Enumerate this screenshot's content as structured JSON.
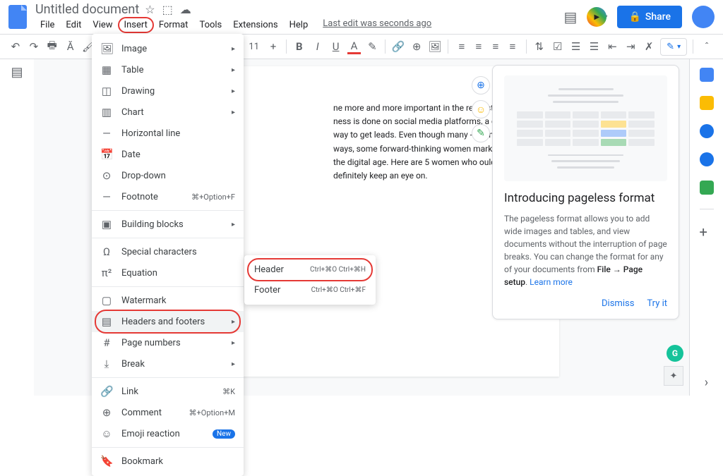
{
  "header": {
    "title": "Untitled document",
    "menus": [
      "File",
      "Edit",
      "View",
      "Insert",
      "Format",
      "Tools",
      "Extensions",
      "Help"
    ],
    "active_menu": "Insert",
    "last_edit": "Last edit was seconds ago",
    "share_label": "Share"
  },
  "toolbar": {
    "font_size": "11",
    "items_after_gap": [
      "B",
      "I",
      "U"
    ]
  },
  "insert_menu": {
    "items": [
      {
        "icon": "🖼",
        "label": "Image",
        "arrow": true
      },
      {
        "icon": "▦",
        "label": "Table",
        "arrow": true
      },
      {
        "icon": "◫",
        "label": "Drawing",
        "arrow": true
      },
      {
        "icon": "▥",
        "label": "Chart",
        "arrow": true
      },
      {
        "icon": "—",
        "label": "Horizontal line"
      },
      {
        "icon": "📅",
        "label": "Date"
      },
      {
        "icon": "⊙",
        "label": "Drop-down"
      },
      {
        "icon": "—",
        "label": "Footnote",
        "shortcut": "⌘+Option+F"
      },
      {
        "sep": true
      },
      {
        "icon": "▣",
        "label": "Building blocks",
        "arrow": true
      },
      {
        "sep": true
      },
      {
        "icon": "Ω",
        "label": "Special characters"
      },
      {
        "icon": "π²",
        "label": "Equation"
      },
      {
        "sep": true
      },
      {
        "icon": "▢",
        "label": "Watermark"
      },
      {
        "icon": "▤",
        "label": "Headers and footers",
        "arrow": true,
        "highlight": true
      },
      {
        "icon": "#",
        "label": "Page numbers",
        "arrow": true
      },
      {
        "icon": "⤓",
        "label": "Break",
        "arrow": true
      },
      {
        "sep": true
      },
      {
        "icon": "🔗",
        "label": "Link",
        "shortcut": "⌘K"
      },
      {
        "icon": "⊕",
        "label": "Comment",
        "shortcut": "⌘+Option+M"
      },
      {
        "icon": "☺",
        "label": "Emoji reaction",
        "badge": "New"
      },
      {
        "sep": true
      },
      {
        "icon": "🔖",
        "label": "Bookmark"
      }
    ]
  },
  "submenu": {
    "items": [
      {
        "label": "Header",
        "shortcut": "Ctrl+⌘O Ctrl+⌘H",
        "highlight": true
      },
      {
        "label": "Footer",
        "shortcut": "Ctrl+⌘O Ctrl+⌘F"
      }
    ]
  },
  "document": {
    "visible_text": "ne more and more important in the real estate ness is done on social media platforms, a good way to get leads. Even though many -and-mortar ways, some forward-thinking women market in the digital age. Here are 5 women who ould definitely keep an eye on."
  },
  "pageless_card": {
    "title": "Introducing pageless format",
    "body_part1": "The pageless format allows you to add wide images and tables, and view documents without the interruption of page breaks. You can change the format for any of your documents from ",
    "body_bold": "File → Page setup",
    "body_part2": ". ",
    "learn_more": "Learn more",
    "dismiss": "Dismiss",
    "try_it": "Try it"
  }
}
